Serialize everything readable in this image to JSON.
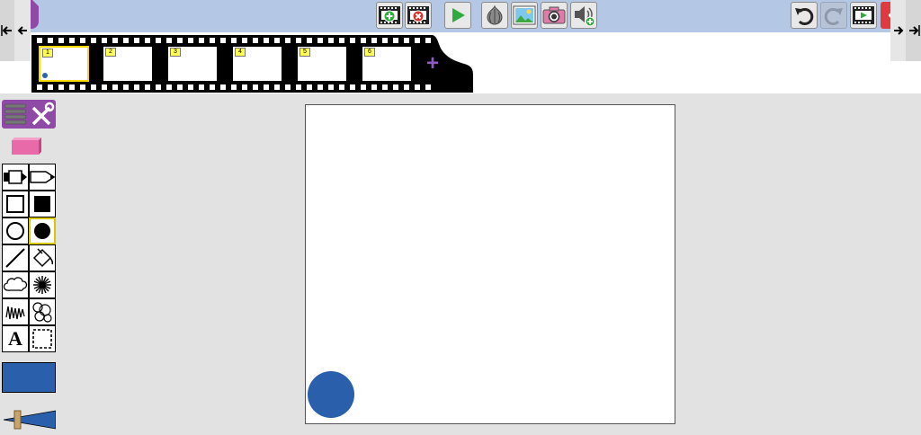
{
  "toolbar": {
    "buttons": [
      {
        "name": "add-frame-button",
        "icon": "film-add-icon"
      },
      {
        "name": "delete-frame-button",
        "icon": "film-delete-icon"
      },
      {
        "name": "play-button",
        "icon": "play-icon"
      },
      {
        "name": "onion-skin-button",
        "icon": "onion-icon"
      },
      {
        "name": "background-image-button",
        "icon": "image-icon"
      },
      {
        "name": "camera-button",
        "icon": "camera-icon"
      },
      {
        "name": "add-sound-button",
        "icon": "speaker-add-icon"
      },
      {
        "name": "undo-button",
        "icon": "undo-icon"
      },
      {
        "name": "redo-button",
        "icon": "redo-icon"
      },
      {
        "name": "preview-movie-button",
        "icon": "film-play-icon"
      },
      {
        "name": "back-button",
        "icon": "arrow-left-icon"
      }
    ]
  },
  "filmstrip": {
    "frames": [
      {
        "number": "1",
        "selected": true
      },
      {
        "number": "2",
        "selected": false
      },
      {
        "number": "3",
        "selected": false
      },
      {
        "number": "4",
        "selected": false
      },
      {
        "number": "5",
        "selected": false
      },
      {
        "number": "6",
        "selected": false
      }
    ],
    "add_label": "+"
  },
  "tools": {
    "text_tool_glyph": "A",
    "current_color": "#2a5fab",
    "selected_tool": "filled-circle"
  },
  "colors": {
    "topbar": "#b4c8e6",
    "menu_purple": "#8e4aa6",
    "accent_red": "#e03a3e",
    "shape_blue": "#2a5fab"
  }
}
